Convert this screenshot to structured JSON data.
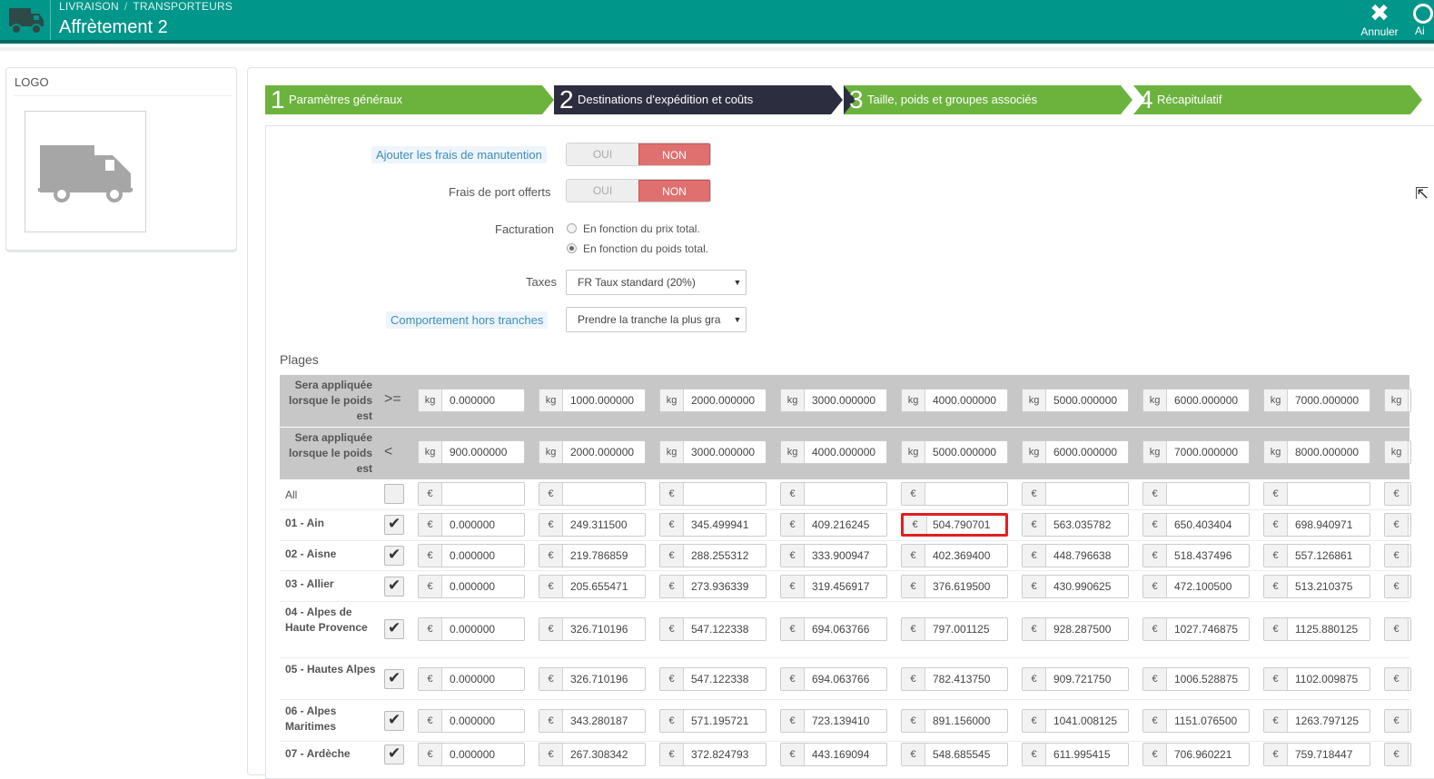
{
  "header": {
    "breadcrumb": [
      "LIVRAISON",
      "TRANSPORTEURS"
    ],
    "title": "Affrètement 2",
    "cancel_label": "Annuler",
    "help_label": "Ai",
    "bg_color": "#00968a"
  },
  "logo_panel": {
    "title": "LOGO"
  },
  "steps": [
    {
      "num": "1",
      "label": "Paramètres généraux",
      "state": "done",
      "color": "#6cb33e"
    },
    {
      "num": "2",
      "label": "Destinations d'expédition et coûts",
      "state": "active",
      "color": "#2c2e40"
    },
    {
      "num": "3",
      "label": "Taille, poids et groupes associés",
      "state": "todo",
      "color": "#6cb33e"
    },
    {
      "num": "4",
      "label": "Récapitulatif",
      "state": "todo",
      "color": "#6cb33e"
    }
  ],
  "form": {
    "handling_label": "Ajouter les frais de manutention",
    "free_shipping_label": "Frais de port offerts",
    "toggle_yes": "OUI",
    "toggle_no": "NON",
    "billing_label": "Facturation",
    "billing_options": [
      "En fonction du prix total.",
      "En fonction du poids total."
    ],
    "billing_selected": 1,
    "taxes_label": "Taxes",
    "taxes_value": "FR Taux standard (20%)",
    "out_of_range_label": "Comportement hors tranches",
    "out_of_range_value": "Prendre la tranche la plus gra"
  },
  "ranges": {
    "title": "Plages",
    "row_ge_label": "Sera appliquée lorsque le poids est",
    "row_ge_op": ">=",
    "row_lt_label": "Sera appliquée lorsque le poids est",
    "row_lt_op": "<",
    "unit": "kg",
    "currency": "€",
    "ge_values": [
      "0.000000",
      "1000.000000",
      "2000.000000",
      "3000.000000",
      "4000.000000",
      "5000.000000",
      "6000.000000",
      "7000.000000",
      ""
    ],
    "lt_values": [
      "900.000000",
      "2000.000000",
      "3000.000000",
      "4000.000000",
      "5000.000000",
      "6000.000000",
      "7000.000000",
      "8000.000000",
      ""
    ],
    "all_label": "All",
    "zones": [
      {
        "name": "01 - Ain",
        "checked": true,
        "prices": [
          "0.000000",
          "249.311500",
          "345.499941",
          "409.216245",
          "504.790701",
          "563.035782",
          "650.403404",
          "698.940971",
          ""
        ]
      },
      {
        "name": "02 - Aisne",
        "checked": true,
        "prices": [
          "0.000000",
          "219.786859",
          "288.255312",
          "333.900947",
          "402.369400",
          "448.796638",
          "518.437496",
          "557.126861",
          ""
        ]
      },
      {
        "name": "03 - Allier",
        "checked": true,
        "prices": [
          "0.000000",
          "205.655471",
          "273.936339",
          "319.456917",
          "376.619500",
          "430.990625",
          "472.100500",
          "513.210375",
          ""
        ]
      },
      {
        "name": "04 - Alpes de Haute Provence",
        "checked": true,
        "prices": [
          "0.000000",
          "326.710196",
          "547.122338",
          "694.063766",
          "797.001125",
          "928.287500",
          "1027.746875",
          "1125.880125",
          ""
        ]
      },
      {
        "name": "05 - Hautes Alpes",
        "checked": true,
        "prices": [
          "0.000000",
          "326.710196",
          "547.122338",
          "694.063766",
          "782.413750",
          "909.721750",
          "1006.528875",
          "1102.009875",
          ""
        ]
      },
      {
        "name": "06 - Alpes Maritimes",
        "checked": true,
        "prices": [
          "0.000000",
          "343.280187",
          "571.195721",
          "723.139410",
          "891.156000",
          "1041.008125",
          "1151.076500",
          "1263.797125",
          ""
        ]
      },
      {
        "name": "07 - Ardèche",
        "checked": true,
        "prices": [
          "0.000000",
          "267.308342",
          "372.824793",
          "443.169094",
          "548.685545",
          "611.995415",
          "706.960221",
          "759.718447",
          ""
        ]
      }
    ]
  }
}
